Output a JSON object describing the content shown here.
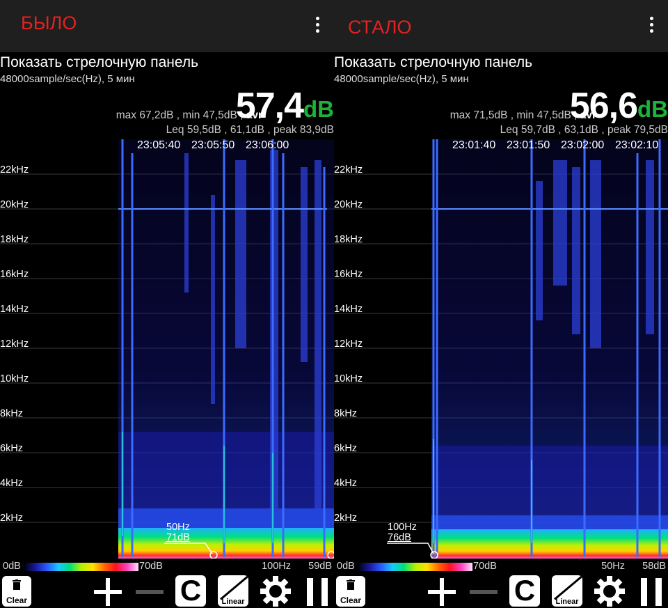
{
  "panels": [
    {
      "label": "БЫЛО",
      "title": "Показать стрелочную панель",
      "subtitle": "48000sample/sec(Hz), 5 мин",
      "stats_line1": {
        "max": "max 67,2dB",
        "min": "min 47,5dB",
        "avr_label": "avr"
      },
      "big_value": "57,4",
      "big_unit": "dB",
      "stats_line2": {
        "leq": "Leq 59,5dB",
        "l2": "61,1dB",
        "peak": "peak 83,9dB"
      },
      "times": [
        "23:05:40",
        "23:05:50",
        "23:06:00"
      ],
      "freq_labels": [
        "22kHz",
        "20kHz",
        "18kHz",
        "16kHz",
        "14kHz",
        "12kHz",
        "10kHz",
        "8kHz",
        "6kHz",
        "4kHz",
        "2kHz"
      ],
      "marker": {
        "freq": "50Hz",
        "db": "71dB"
      },
      "legend": {
        "min": "0dB",
        "max": "70dB",
        "freq": "100Hz",
        "db": "59dB"
      },
      "toolbar": {
        "clear_label": "Clear",
        "c_label": "C",
        "linear_label": "Linear"
      }
    },
    {
      "label": "СТАЛО",
      "title": "Показать стрелочную панель",
      "subtitle": "48000sample/sec(Hz), 5 мин",
      "stats_line1": {
        "max": "max 71,5dB",
        "min": "min 47,5dB",
        "avr_label": "avr"
      },
      "big_value": "56,6",
      "big_unit": "dB",
      "stats_line2": {
        "leq": "Leq 59,7dB",
        "l2": "63,1dB",
        "peak": "peak 79,5dB"
      },
      "times": [
        "23:01:40",
        "23:01:50",
        "23:02:00",
        "23:02:10"
      ],
      "freq_labels": [
        "22kHz",
        "20kHz",
        "18kHz",
        "16kHz",
        "14kHz",
        "12kHz",
        "10kHz",
        "8kHz",
        "6kHz",
        "4kHz",
        "2kHz"
      ],
      "marker": {
        "freq": "100Hz",
        "db": "76dB"
      },
      "legend": {
        "min": "0dB",
        "max": "70dB",
        "freq": "50Hz",
        "db": "58dB"
      },
      "toolbar": {
        "clear_label": "Clear",
        "c_label": "C",
        "linear_label": "Linear"
      }
    }
  ],
  "colors": {
    "label_red": "#e32222",
    "db_green": "#1cb33a",
    "topbar": "#1f1f1f"
  }
}
